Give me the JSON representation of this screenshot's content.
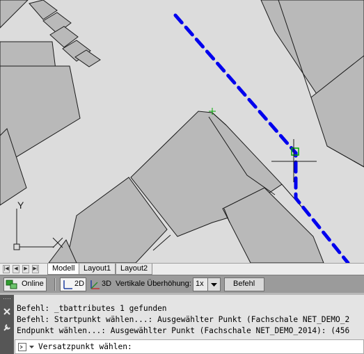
{
  "layout_tabs": {
    "items": [
      {
        "label": "Modell",
        "active": true
      },
      {
        "label": "Layout1",
        "active": false
      },
      {
        "label": "Layout2",
        "active": false
      }
    ]
  },
  "status_bar": {
    "online_label": "Online",
    "view_2d_label": "2D",
    "view_3d_label": "3D",
    "exaggeration_label": "Vertikale Überhöhung:",
    "exaggeration_value": "1x",
    "command_button_label": "Befehl"
  },
  "ucs": {
    "y_label": "Y",
    "x_label": "X"
  },
  "command_line": {
    "history": [
      "Befehl: _tbattributes 1 gefunden",
      "Befehl: Startpunkt wählen...: Ausgewählter Punkt (Fachschale NET_DEMO_2",
      "Endpunkt wählen...: Ausgewählter Punkt (Fachschale NET_DEMO_2014): (456"
    ],
    "prompt": "Versatzpunkt wählen:"
  },
  "colors": {
    "canvas_background": "#dcdcdc",
    "parcel_fill": "#b9b9b9",
    "line_highlight": "#0000ee",
    "snap_marker": "#00aa00"
  }
}
